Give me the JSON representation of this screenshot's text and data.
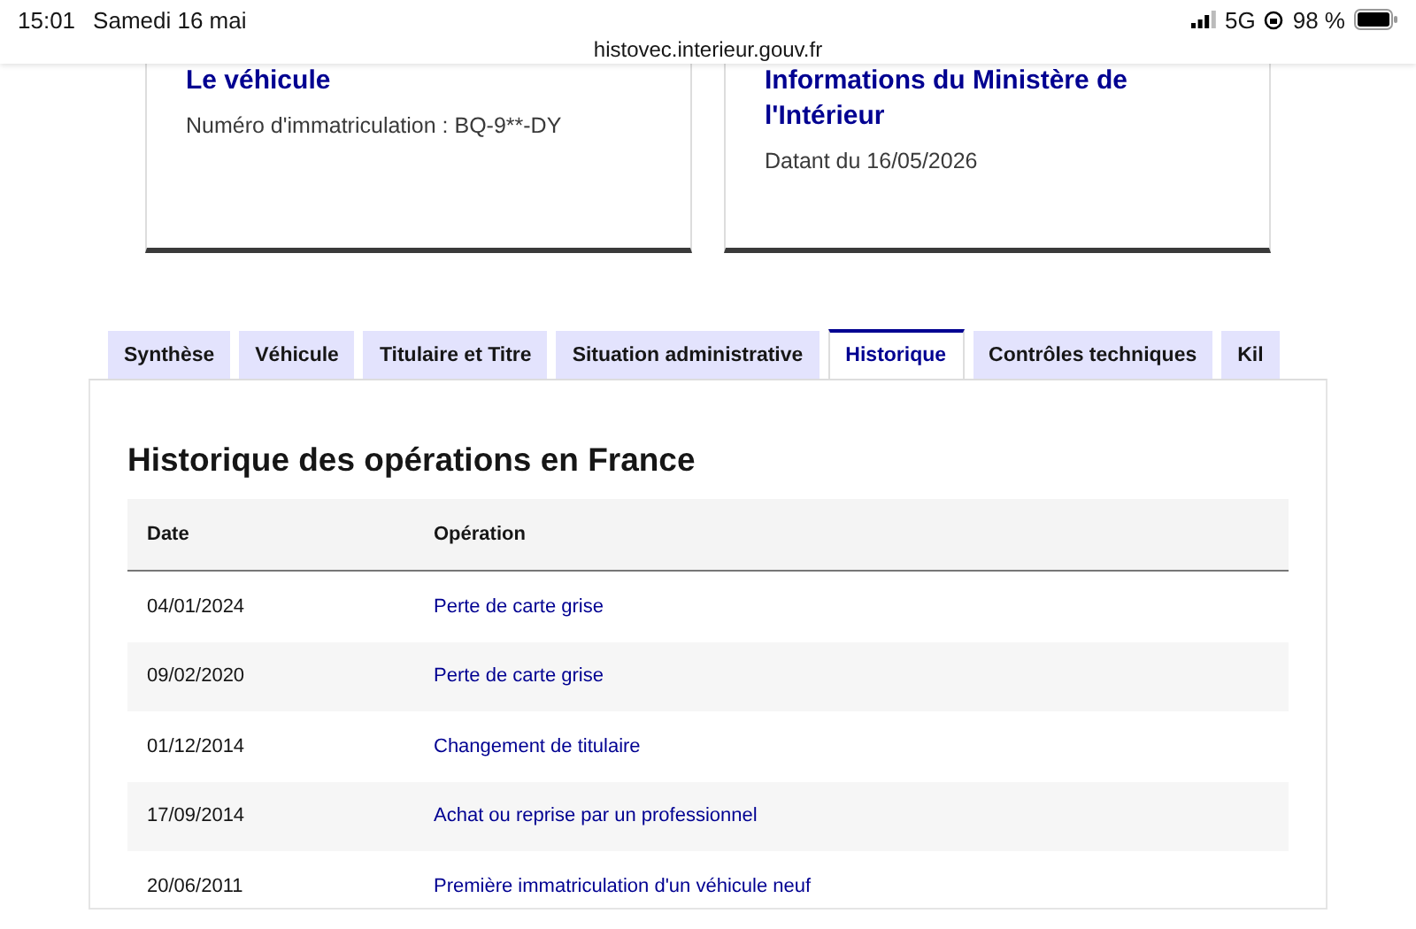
{
  "status_bar": {
    "time": "15:01",
    "date": "Samedi 16 mai",
    "url": "histovec.interieur.gouv.fr",
    "network": "5G",
    "battery": "98 %"
  },
  "cards": [
    {
      "title": "Le véhicule",
      "text": "Numéro d'immatriculation : BQ-9**-DY"
    },
    {
      "title": "Informations du Ministère de l'Intérieur",
      "text": "Datant du 16/05/2026"
    }
  ],
  "tabs": [
    {
      "label": "Synthèse",
      "selected": false
    },
    {
      "label": "Véhicule",
      "selected": false
    },
    {
      "label": "Titulaire et Titre",
      "selected": false
    },
    {
      "label": "Situation administrative",
      "selected": false
    },
    {
      "label": "Historique",
      "selected": true
    },
    {
      "label": "Contrôles techniques",
      "selected": false
    },
    {
      "label": "Kil",
      "selected": false
    }
  ],
  "panel": {
    "title": "Historique des opérations en France",
    "table": {
      "columns": [
        "Date",
        "Opération"
      ],
      "rows": [
        [
          "04/01/2024",
          "Perte de carte grise"
        ],
        [
          "09/02/2020",
          "Perte de carte grise"
        ],
        [
          "01/12/2014",
          "Changement de titulaire"
        ],
        [
          "17/09/2014",
          "Achat ou reprise par un professionnel"
        ],
        [
          "20/06/2011",
          "Première immatriculation d'un véhicule neuf"
        ]
      ]
    }
  }
}
